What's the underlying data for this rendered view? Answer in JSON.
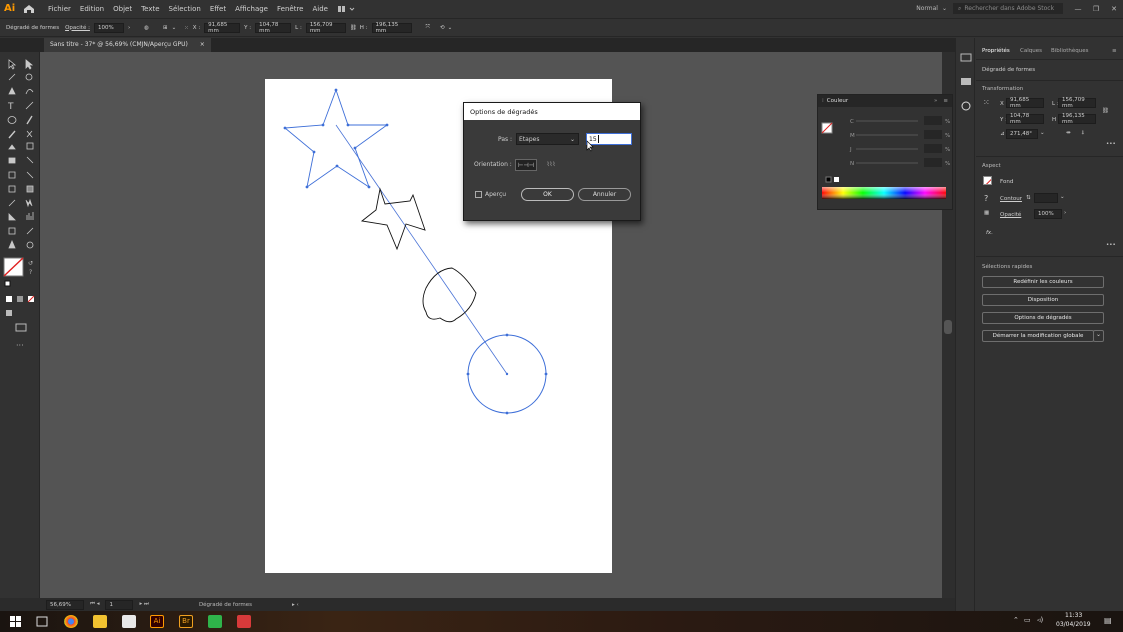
{
  "menubar": {
    "logo": "Ai",
    "items": [
      "Fichier",
      "Edition",
      "Objet",
      "Texte",
      "Sélection",
      "Effet",
      "Affichage",
      "Fenêtre",
      "Aide"
    ],
    "workspace": "Normal",
    "search_placeholder": "Rechercher dans Adobe Stock"
  },
  "control_bar": {
    "tool_label": "Dégradé de formes",
    "opacity_label": "Opacité :",
    "opacity_value": "100%",
    "x_label": "X :",
    "x_value": "91,685 mm",
    "y_label": "Y :",
    "y_value": "104,78 mm",
    "l_label": "L :",
    "l_value": "156,709 mm",
    "h_label": "H :",
    "h_value": "196,135 mm"
  },
  "document_tab": {
    "title": "Sans titre - 37* @ 56,69% (CMJN/Aperçu GPU)",
    "close": "×"
  },
  "status_bar": {
    "zoom": "56,69%",
    "page": "1",
    "tool": "Dégradé de formes"
  },
  "color_panel": {
    "title": "Couleur",
    "channels": [
      "C",
      "M",
      "J",
      "N"
    ],
    "unit": "%"
  },
  "dialog": {
    "title": "Options de dégradés",
    "pas_label": "Pas :",
    "pas_value": "Etapes",
    "steps_value": "15",
    "orientation_label": "Orientation :",
    "preview_label": "Aperçu",
    "ok_label": "OK",
    "cancel_label": "Annuler"
  },
  "properties": {
    "tabs": [
      "Propriétés",
      "Calques",
      "Bibliothèques"
    ],
    "subtitle": "Dégradé de formes",
    "transform_title": "Transformation",
    "x_label": "X :",
    "x_value": "91,685 mm",
    "y_label": "Y :",
    "y_value": "104,78 mm",
    "l_label": "L :",
    "l_value": "156,709 mm",
    "h_label": "H :",
    "h_value": "196,135 mm",
    "angle_value": "271,48°",
    "aspect_title": "Aspect",
    "fond_label": "Fond",
    "contour_label": "Contour",
    "opacity_label": "Opacité",
    "opacity_value": "100%",
    "fx_label": "fx.",
    "quick_actions_title": "Sélections rapides",
    "btn_redefine": "Redéfinir les couleurs",
    "btn_layout": "Disposition",
    "btn_blend_options": "Options de dégradés",
    "btn_disassemble": "Démarrer la modification globale"
  },
  "taskbar": {
    "time": "11:33",
    "date": "03/04/2019"
  },
  "colors": {
    "accent": "#3e6fd8",
    "app_bg": "#323232",
    "canvas_bg": "#545454"
  }
}
